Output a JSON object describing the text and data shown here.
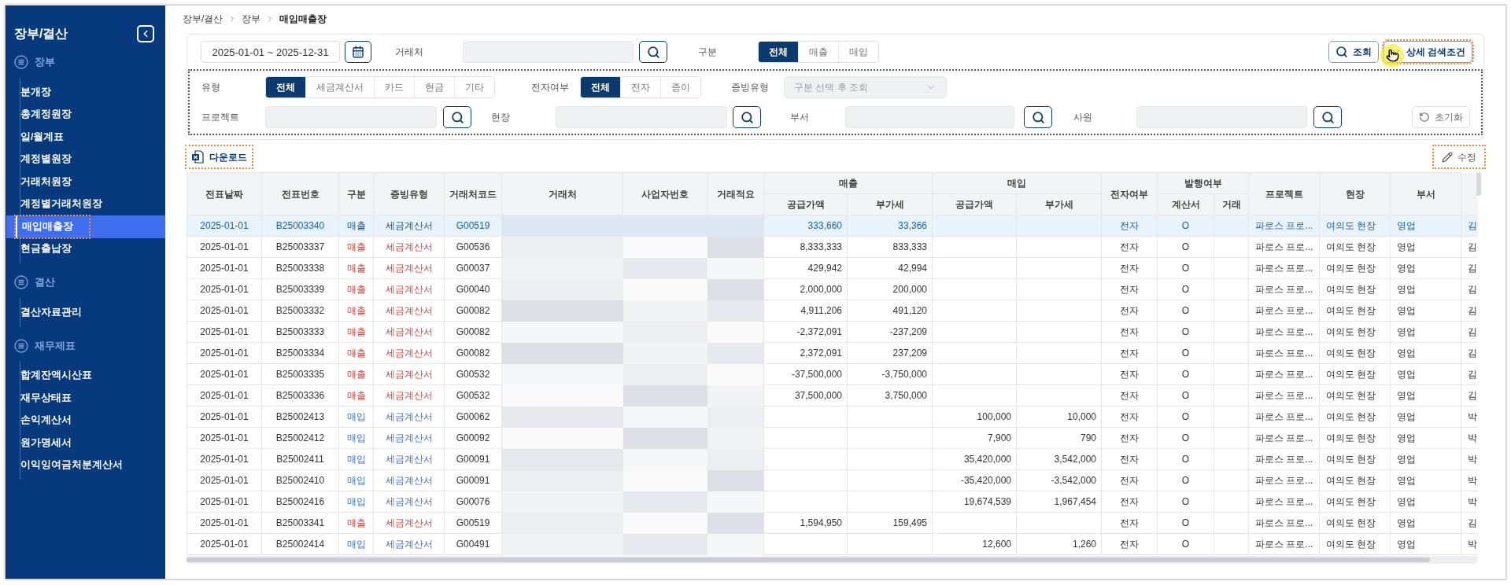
{
  "sidebar": {
    "title": "장부/결산",
    "sections": [
      {
        "label": "장부",
        "items": [
          {
            "label": "분개장",
            "selected": false,
            "highlighted": false
          },
          {
            "label": "총계정원장",
            "selected": false,
            "highlighted": false
          },
          {
            "label": "일/월계표",
            "selected": false,
            "highlighted": false
          },
          {
            "label": "계정별원장",
            "selected": false,
            "highlighted": false
          },
          {
            "label": "거래처원장",
            "selected": false,
            "highlighted": false
          },
          {
            "label": "계정별거래처원장",
            "selected": false,
            "highlighted": false
          },
          {
            "label": "매입매출장",
            "selected": true,
            "highlighted": true
          },
          {
            "label": "현금출납장",
            "selected": false,
            "highlighted": false
          }
        ]
      },
      {
        "label": "결산",
        "items": [
          {
            "label": "결산자료관리",
            "selected": false,
            "highlighted": false
          }
        ]
      },
      {
        "label": "재무제표",
        "items": [
          {
            "label": "합계잔액시산표",
            "selected": false,
            "highlighted": false
          },
          {
            "label": "재무상태표",
            "selected": false,
            "highlighted": false
          },
          {
            "label": "손익계산서",
            "selected": false,
            "highlighted": false
          },
          {
            "label": "원가명세서",
            "selected": false,
            "highlighted": false
          },
          {
            "label": "이익잉여금처분계산서",
            "selected": false,
            "highlighted": false
          }
        ]
      }
    ]
  },
  "breadcrumb": [
    "장부/결산",
    "장부",
    "매입매출장"
  ],
  "filters": {
    "date_range": {
      "value": "2025-01-01 ~ 2025-12-31"
    },
    "vendor": {
      "label": "거래처"
    },
    "division": {
      "label": "구분",
      "options": [
        {
          "label": "전체",
          "selected": true
        },
        {
          "label": "매출",
          "selected": false
        },
        {
          "label": "매입",
          "selected": false
        }
      ]
    },
    "type": {
      "label": "유형",
      "options": [
        {
          "label": "전체",
          "selected": true
        },
        {
          "label": "세금계산서",
          "selected": false
        },
        {
          "label": "카드",
          "selected": false
        },
        {
          "label": "현금",
          "selected": false
        },
        {
          "label": "기타",
          "selected": false
        }
      ]
    },
    "electronic": {
      "label": "전자여부",
      "options": [
        {
          "label": "전체",
          "selected": true
        },
        {
          "label": "전자",
          "selected": false
        },
        {
          "label": "종이",
          "selected": false
        }
      ]
    },
    "evidence_type": {
      "label": "증빙유형",
      "placeholder": "구분 선택 후 조회",
      "disabled": true
    },
    "project": {
      "label": "프로젝트"
    },
    "site": {
      "label": "현장"
    },
    "department": {
      "label": "부서"
    },
    "employee": {
      "label": "사원"
    }
  },
  "search_button": {
    "label": "조회"
  },
  "detail_button": {
    "label": "상세 검색조건",
    "highlighted": true
  },
  "reset_button": {
    "label": "초기화"
  },
  "download_button": {
    "label": "다운로드",
    "highlighted": true
  },
  "edit_button": {
    "label": "수정",
    "highlighted": true
  },
  "table": {
    "columns": [
      {
        "label": "전표날짜"
      },
      {
        "label": "전표번호"
      },
      {
        "label": "구분"
      },
      {
        "label": "증빙유형"
      },
      {
        "label": "거래처코드"
      },
      {
        "label": "거래처"
      },
      {
        "label": "사업자번호"
      },
      {
        "label": "거래적요"
      },
      {
        "label": "매출",
        "children": [
          {
            "label": "공급가액"
          },
          {
            "label": "부가세"
          }
        ]
      },
      {
        "label": "매입",
        "children": [
          {
            "label": "공급가액"
          },
          {
            "label": "부가세"
          }
        ]
      },
      {
        "label": "전자여부"
      },
      {
        "label": "발행여부",
        "children": [
          {
            "label": "계산서"
          },
          {
            "label": "거래"
          }
        ]
      },
      {
        "label": "프로젝트"
      },
      {
        "label": "현장"
      },
      {
        "label": "부서"
      }
    ],
    "rows": [
      {
        "kind": "sales",
        "selected": true,
        "date": "2025-01-01",
        "voucher_no": "B25003340",
        "division": "매출",
        "evidence_type": "세금계산서",
        "vendor_code": "G00519",
        "sales_supply": "333,660",
        "sales_vat": "33,366",
        "electronic": "전자",
        "invoice_issued": "O",
        "project": "파로스 프로...",
        "site": "여의도 현장",
        "department": "영업",
        "column_19": "김"
      },
      {
        "kind": "sales",
        "selected": false,
        "date": "2025-01-01",
        "voucher_no": "B25003337",
        "division": "매출",
        "evidence_type": "세금계산서",
        "vendor_code": "G00536",
        "sales_supply": "8,333,333",
        "sales_vat": "833,333",
        "electronic": "전자",
        "invoice_issued": "O",
        "project": "파로스 프로...",
        "site": "여의도 현장",
        "department": "영업",
        "column_19": "김"
      },
      {
        "kind": "sales",
        "selected": false,
        "date": "2025-01-01",
        "voucher_no": "B25003338",
        "division": "매출",
        "evidence_type": "세금계산서",
        "vendor_code": "G00037",
        "sales_supply": "429,942",
        "sales_vat": "42,994",
        "electronic": "전자",
        "invoice_issued": "O",
        "project": "파로스 프로...",
        "site": "여의도 현장",
        "department": "영업",
        "column_19": "김"
      },
      {
        "kind": "sales",
        "selected": false,
        "date": "2025-01-01",
        "voucher_no": "B25003339",
        "division": "매출",
        "evidence_type": "세금계산서",
        "vendor_code": "G00040",
        "sales_supply": "2,000,000",
        "sales_vat": "200,000",
        "electronic": "전자",
        "invoice_issued": "O",
        "project": "파로스 프로...",
        "site": "여의도 현장",
        "department": "영업",
        "column_19": "김"
      },
      {
        "kind": "sales",
        "selected": false,
        "date": "2025-01-01",
        "voucher_no": "B25003332",
        "division": "매출",
        "evidence_type": "세금계산서",
        "vendor_code": "G00082",
        "sales_supply": "4,911,206",
        "sales_vat": "491,120",
        "electronic": "전자",
        "invoice_issued": "O",
        "project": "파로스 프로...",
        "site": "여의도 현장",
        "department": "영업",
        "column_19": "김"
      },
      {
        "kind": "sales",
        "selected": false,
        "date": "2025-01-01",
        "voucher_no": "B25003333",
        "division": "매출",
        "evidence_type": "세금계산서",
        "vendor_code": "G00082",
        "sales_supply": "-2,372,091",
        "sales_vat": "-237,209",
        "electronic": "전자",
        "invoice_issued": "O",
        "project": "파로스 프로...",
        "site": "여의도 현장",
        "department": "영업",
        "column_19": "김"
      },
      {
        "kind": "sales",
        "selected": false,
        "date": "2025-01-01",
        "voucher_no": "B25003334",
        "division": "매출",
        "evidence_type": "세금계산서",
        "vendor_code": "G00082",
        "sales_supply": "2,372,091",
        "sales_vat": "237,209",
        "electronic": "전자",
        "invoice_issued": "O",
        "project": "파로스 프로...",
        "site": "여의도 현장",
        "department": "영업",
        "column_19": "김"
      },
      {
        "kind": "sales",
        "selected": false,
        "date": "2025-01-01",
        "voucher_no": "B25003335",
        "division": "매출",
        "evidence_type": "세금계산서",
        "vendor_code": "G00532",
        "sales_supply": "-37,500,000",
        "sales_vat": "-3,750,000",
        "electronic": "전자",
        "invoice_issued": "O",
        "project": "파로스 프로...",
        "site": "여의도 현장",
        "department": "영업",
        "column_19": "김"
      },
      {
        "kind": "sales",
        "selected": false,
        "date": "2025-01-01",
        "voucher_no": "B25003336",
        "division": "매출",
        "evidence_type": "세금계산서",
        "vendor_code": "G00532",
        "sales_supply": "37,500,000",
        "sales_vat": "3,750,000",
        "electronic": "전자",
        "invoice_issued": "O",
        "project": "파로스 프로...",
        "site": "여의도 현장",
        "department": "영업",
        "column_19": "김"
      },
      {
        "kind": "purchase",
        "selected": false,
        "date": "2025-01-01",
        "voucher_no": "B25002413",
        "division": "매입",
        "evidence_type": "세금계산서",
        "vendor_code": "G00062",
        "purchase_supply": "100,000",
        "purchase_vat": "10,000",
        "electronic": "전자",
        "invoice_issued": "O",
        "project": "파로스 프로...",
        "site": "여의도 현장",
        "department": "영업",
        "column_19": "박"
      },
      {
        "kind": "purchase",
        "selected": false,
        "date": "2025-01-01",
        "voucher_no": "B25002412",
        "division": "매입",
        "evidence_type": "세금계산서",
        "vendor_code": "G00092",
        "purchase_supply": "7,900",
        "purchase_vat": "790",
        "electronic": "전자",
        "invoice_issued": "O",
        "project": "파로스 프로...",
        "site": "여의도 현장",
        "department": "영업",
        "column_19": "박"
      },
      {
        "kind": "purchase",
        "selected": false,
        "date": "2025-01-01",
        "voucher_no": "B25002411",
        "division": "매입",
        "evidence_type": "세금계산서",
        "vendor_code": "G00091",
        "purchase_supply": "35,420,000",
        "purchase_vat": "3,542,000",
        "electronic": "전자",
        "invoice_issued": "O",
        "project": "파로스 프로...",
        "site": "여의도 현장",
        "department": "영업",
        "column_19": "박"
      },
      {
        "kind": "purchase",
        "selected": false,
        "date": "2025-01-01",
        "voucher_no": "B25002410",
        "division": "매입",
        "evidence_type": "세금계산서",
        "vendor_code": "G00091",
        "purchase_supply": "-35,420,000",
        "purchase_vat": "-3,542,000",
        "electronic": "전자",
        "invoice_issued": "O",
        "project": "파로스 프로...",
        "site": "여의도 현장",
        "department": "영업",
        "column_19": "박"
      },
      {
        "kind": "purchase",
        "selected": false,
        "date": "2025-01-01",
        "voucher_no": "B25002416",
        "division": "매입",
        "evidence_type": "세금계산서",
        "vendor_code": "G00076",
        "purchase_supply": "19,674,539",
        "purchase_vat": "1,967,454",
        "electronic": "전자",
        "invoice_issued": "O",
        "project": "파로스 프로...",
        "site": "여의도 현장",
        "department": "영업",
        "column_19": "박"
      },
      {
        "kind": "sales",
        "selected": false,
        "date": "2025-01-01",
        "voucher_no": "B25003341",
        "division": "매출",
        "evidence_type": "세금계산서",
        "vendor_code": "G00519",
        "sales_supply": "1,594,950",
        "sales_vat": "159,495",
        "electronic": "전자",
        "invoice_issued": "O",
        "project": "파로스 프로...",
        "site": "여의도 현장",
        "department": "영업",
        "column_19": "김"
      },
      {
        "kind": "purchase",
        "selected": false,
        "date": "2025-01-01",
        "voucher_no": "B25002414",
        "division": "매입",
        "evidence_type": "세금계산서",
        "vendor_code": "G00491",
        "purchase_supply": "12,600",
        "purchase_vat": "1,260",
        "electronic": "전자",
        "invoice_issued": "O",
        "project": "파로스 프로...",
        "site": "여의도 현장",
        "department": "영업",
        "column_19": "박"
      }
    ]
  }
}
